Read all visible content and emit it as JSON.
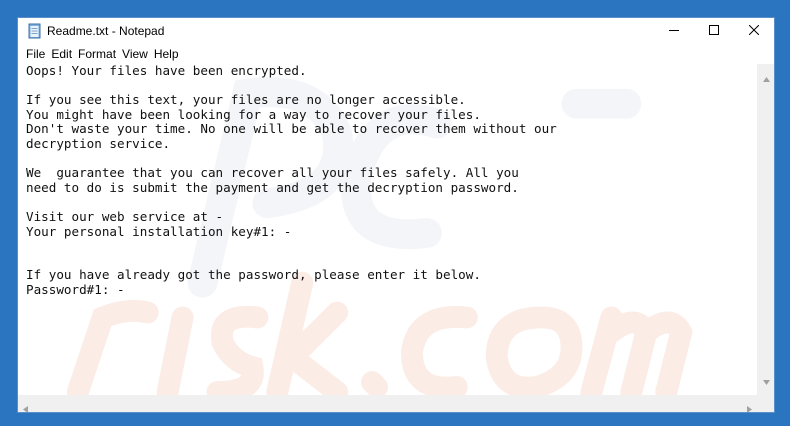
{
  "window": {
    "title": "Readme.txt - Notepad"
  },
  "menu": {
    "file": "File",
    "edit": "Edit",
    "format": "Format",
    "view": "View",
    "help": "Help"
  },
  "document": {
    "lines": [
      "Oops! Your files have been encrypted.",
      "",
      "If you see this text, your files are no longer accessible.",
      "You might have been looking for a way to recover your files.",
      "Don't waste your time. No one will be able to recover them without our",
      "decryption service.",
      "",
      "We  guarantee that you can recover all your files safely. All you",
      "need to do is submit the payment and get the decryption password.",
      "",
      "Visit our web service at -",
      "Your personal installation key#1: -",
      "",
      "",
      "If you have already got the password, please enter it below.",
      "Password#1: -"
    ]
  },
  "icons": {
    "app": "notepad-icon",
    "minimize": "minimize-icon",
    "maximize": "maximize-icon",
    "close": "close-icon"
  },
  "colors": {
    "desktop": "#2b74bf",
    "window_border": "#5a8fc8",
    "scrollbar": "#f0f0f0"
  }
}
